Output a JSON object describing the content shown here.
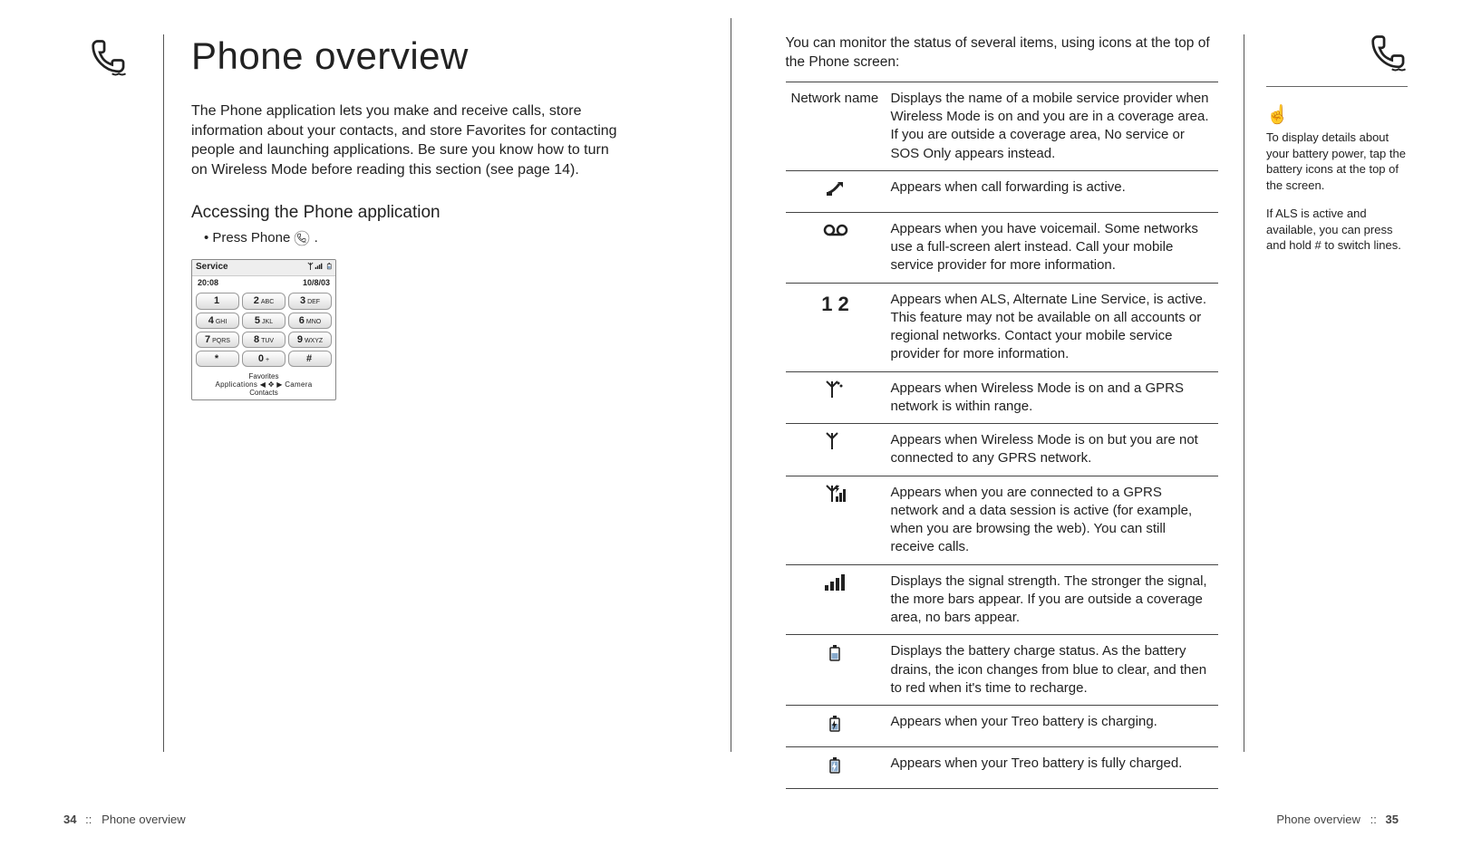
{
  "left": {
    "title": "Phone overview",
    "intro": "The Phone application lets you make and receive calls, store information about your contacts, and store Favorites for contacting people and launching applications. Be sure you know how to turn on Wireless Mode before reading this section (see page 14).",
    "subhead": "Accessing the Phone application",
    "bullet": "Press Phone",
    "device": {
      "service": "Service",
      "time": "20:08",
      "date": "10/8/03",
      "keys": [
        {
          "n": "1",
          "l": ""
        },
        {
          "n": "2",
          "l": "ABC"
        },
        {
          "n": "3",
          "l": "DEF"
        },
        {
          "n": "4",
          "l": "GHI"
        },
        {
          "n": "5",
          "l": "JKL"
        },
        {
          "n": "6",
          "l": "MNO"
        },
        {
          "n": "7",
          "l": "PQRS"
        },
        {
          "n": "8",
          "l": "TUV"
        },
        {
          "n": "9",
          "l": "WXYZ"
        },
        {
          "n": "*",
          "l": ""
        },
        {
          "n": "0",
          "l": "+"
        },
        {
          "n": "#",
          "l": ""
        }
      ],
      "bottom1": "Favorites",
      "bottom2": "Applications ◀ ✥ ▶ Camera",
      "bottom3": "Contacts"
    }
  },
  "right": {
    "lead": "You can monitor the status of several items, using icons at the top of the Phone screen:",
    "rows": [
      {
        "label": "Network name",
        "icon": "",
        "desc": "Displays the name of a mobile service provider when Wireless Mode is on and you are in a coverage area. If you are outside a coverage area, No service or SOS Only appears instead."
      },
      {
        "label": "",
        "icon": "call-forward",
        "desc": "Appears when call forwarding is active."
      },
      {
        "label": "",
        "icon": "voicemail",
        "desc": "Appears when you have voicemail. Some networks use a full-screen alert instead. Call your mobile service provider for more information."
      },
      {
        "label": "",
        "icon": "als",
        "desc": "Appears when ALS, Alternate Line Service, is active. This feature may not be available on all accounts or regional networks. Contact your mobile service provider for more information."
      },
      {
        "label": "",
        "icon": "gprs-in-range",
        "desc": "Appears when Wireless Mode is on and a GPRS network is within range."
      },
      {
        "label": "",
        "icon": "wireless-no-gprs",
        "desc": "Appears when Wireless Mode is on but you are not connected to any GPRS network."
      },
      {
        "label": "",
        "icon": "gprs-active",
        "desc": "Appears when you are connected to a GPRS network and a data session is active (for example, when you are browsing the web). You can still receive calls."
      },
      {
        "label": "",
        "icon": "signal",
        "desc": "Displays the signal strength. The stronger the signal, the more bars appear. If you are outside a coverage area, no bars appear."
      },
      {
        "label": "",
        "icon": "battery",
        "desc": "Displays the battery charge status. As the battery drains, the icon changes from blue to clear, and then to red when it's time to recharge."
      },
      {
        "label": "",
        "icon": "charging",
        "desc": "Appears when your Treo battery is charging."
      },
      {
        "label": "",
        "icon": "full",
        "desc": "Appears when your Treo battery is fully charged."
      }
    ],
    "tips": [
      "To display details about your battery power, tap the battery icons at the top of the screen.",
      "If ALS is active and available, you can press and hold # to switch lines."
    ]
  },
  "footer": {
    "left_num": "34",
    "left_text": "Phone overview",
    "right_text": "Phone overview",
    "right_num": "35",
    "sep": "::"
  }
}
